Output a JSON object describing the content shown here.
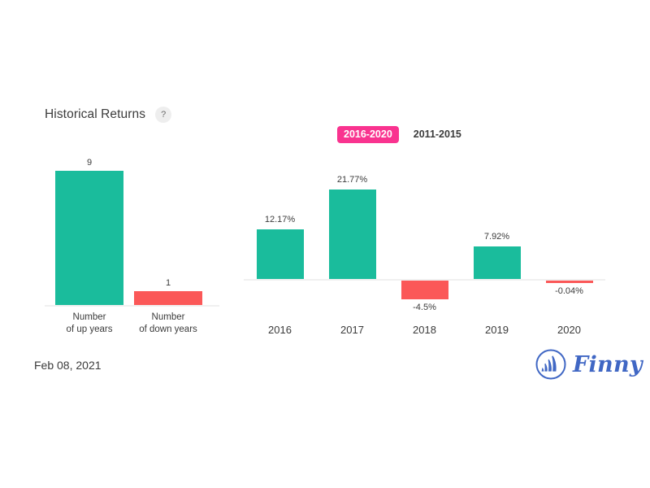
{
  "header": {
    "title": "Historical Returns",
    "help_icon": "question-mark-icon",
    "help_label": "?"
  },
  "period_toggle": {
    "options": [
      {
        "label": "2016-2020",
        "active": true
      },
      {
        "label": "2011-2015",
        "active": false
      }
    ],
    "active_color": "#f9338f",
    "active_text_color": "#ffffff"
  },
  "footer": {
    "date": "Feb 08, 2021",
    "brand": "Finny",
    "brand_color": "#4067c4",
    "brand_icon": "finny-flame-circle-icon"
  },
  "colors": {
    "positive": "#1abc9c",
    "negative": "#fb5858",
    "axis": "#f0f0f0",
    "text": "#3b3b3b"
  },
  "chart_data": [
    {
      "type": "bar",
      "name": "year-counts",
      "title": "",
      "xlabel": "",
      "ylabel": "",
      "categories": [
        "Number\nof up years",
        "Number\nof down years"
      ],
      "category_lines": [
        [
          "Number",
          "of up years"
        ],
        [
          "Number",
          "of down years"
        ]
      ],
      "values": [
        9,
        1
      ],
      "value_labels": [
        "9",
        "1"
      ],
      "colors": [
        "#1abc9c",
        "#fb5858"
      ],
      "ylim": [
        0,
        9
      ],
      "grid": false,
      "legend": "none"
    },
    {
      "type": "bar",
      "name": "annual-returns",
      "title": "",
      "xlabel": "",
      "ylabel": "",
      "categories": [
        "2016",
        "2017",
        "2018",
        "2019",
        "2020"
      ],
      "values": [
        12.17,
        21.77,
        -4.5,
        7.92,
        -0.04
      ],
      "value_labels": [
        "12.17%",
        "21.77%",
        "-4.5%",
        "7.92%",
        "-0.04%"
      ],
      "colors": [
        "#1abc9c",
        "#1abc9c",
        "#fb5858",
        "#1abc9c",
        "#fb5858"
      ],
      "ylim": [
        -4.5,
        21.77
      ],
      "grid": false,
      "legend": "none",
      "period": "2016-2020"
    }
  ]
}
